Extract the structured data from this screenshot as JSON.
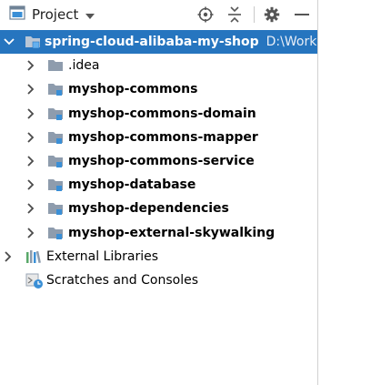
{
  "toolbar": {
    "view_selector_label": "Project",
    "icons": [
      "select-opened-file-icon",
      "collapse-all-icon",
      "settings-gear-icon",
      "hide-minimize-icon"
    ]
  },
  "tree": {
    "root": {
      "label": "spring-cloud-alibaba-my-shop",
      "path": "D:\\Work"
    },
    "children": [
      {
        "label": ".idea"
      },
      {
        "label": "myshop-commons"
      },
      {
        "label": "myshop-commons-domain"
      },
      {
        "label": "myshop-commons-mapper"
      },
      {
        "label": "myshop-commons-service"
      },
      {
        "label": "myshop-database"
      },
      {
        "label": "myshop-dependencies"
      },
      {
        "label": "myshop-external-skywalking"
      }
    ],
    "external_libraries": "External Libraries",
    "scratches": "Scratches and Consoles"
  },
  "colors": {
    "selection": "#2675bf",
    "folder": "#8e9cad",
    "module_badge": "#3a8fd6",
    "arrow": "#4a4a4a"
  }
}
